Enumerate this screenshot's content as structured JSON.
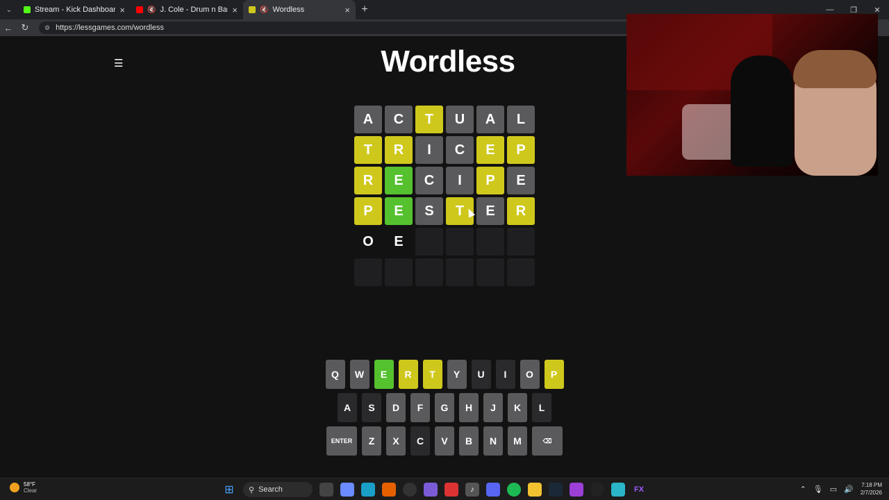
{
  "browser": {
    "tabs": [
      {
        "title": "Stream - Kick Dashboard",
        "color": "#53fc18"
      },
      {
        "title": "J. Cole - Drum n Bass (Official",
        "color": "#ff0000"
      },
      {
        "title": "Wordless",
        "color": "#cfc81c"
      }
    ],
    "url": "https://lessgames.com/wordless"
  },
  "game": {
    "title": "Wordless",
    "rows": [
      [
        {
          "l": "A",
          "s": "g"
        },
        {
          "l": "C",
          "s": "g"
        },
        {
          "l": "T",
          "s": "y"
        },
        {
          "l": "U",
          "s": "g"
        },
        {
          "l": "A",
          "s": "g"
        },
        {
          "l": "L",
          "s": "g"
        }
      ],
      [
        {
          "l": "T",
          "s": "y"
        },
        {
          "l": "R",
          "s": "y"
        },
        {
          "l": "I",
          "s": "g"
        },
        {
          "l": "C",
          "s": "g"
        },
        {
          "l": "E",
          "s": "y"
        },
        {
          "l": "P",
          "s": "y"
        }
      ],
      [
        {
          "l": "R",
          "s": "y"
        },
        {
          "l": "E",
          "s": "gr"
        },
        {
          "l": "C",
          "s": "g"
        },
        {
          "l": "I",
          "s": "g"
        },
        {
          "l": "P",
          "s": "y"
        },
        {
          "l": "E",
          "s": "g"
        }
      ],
      [
        {
          "l": "P",
          "s": "y"
        },
        {
          "l": "E",
          "s": "gr"
        },
        {
          "l": "S",
          "s": "g"
        },
        {
          "l": "T",
          "s": "y"
        },
        {
          "l": "E",
          "s": "g"
        },
        {
          "l": "R",
          "s": "y"
        }
      ],
      [
        {
          "l": "O",
          "s": "b"
        },
        {
          "l": "E",
          "s": "b"
        },
        {
          "l": "",
          "s": "e"
        },
        {
          "l": "",
          "s": "e"
        },
        {
          "l": "",
          "s": "e"
        },
        {
          "l": "",
          "s": "e"
        }
      ],
      [
        {
          "l": "",
          "s": "e"
        },
        {
          "l": "",
          "s": "e"
        },
        {
          "l": "",
          "s": "e"
        },
        {
          "l": "",
          "s": "e"
        },
        {
          "l": "",
          "s": "e"
        },
        {
          "l": "",
          "s": "e"
        }
      ]
    ],
    "keyboard": [
      [
        {
          "k": "Q",
          "s": "g"
        },
        {
          "k": "W",
          "s": "g"
        },
        {
          "k": "E",
          "s": "gr"
        },
        {
          "k": "R",
          "s": "y"
        },
        {
          "k": "T",
          "s": "y"
        },
        {
          "k": "Y",
          "s": "g"
        },
        {
          "k": "U",
          "s": "dark"
        },
        {
          "k": "I",
          "s": "dark"
        },
        {
          "k": "O",
          "s": "g"
        },
        {
          "k": "P",
          "s": "y"
        }
      ],
      [
        {
          "k": "A",
          "s": "dark"
        },
        {
          "k": "S",
          "s": "dark"
        },
        {
          "k": "D",
          "s": "g"
        },
        {
          "k": "F",
          "s": "g"
        },
        {
          "k": "G",
          "s": "g"
        },
        {
          "k": "H",
          "s": "g"
        },
        {
          "k": "J",
          "s": "g"
        },
        {
          "k": "K",
          "s": "g"
        },
        {
          "k": "L",
          "s": "dark"
        }
      ],
      [
        {
          "k": "ENTER",
          "s": "g",
          "wide": true
        },
        {
          "k": "Z",
          "s": "g"
        },
        {
          "k": "X",
          "s": "g"
        },
        {
          "k": "C",
          "s": "dark"
        },
        {
          "k": "V",
          "s": "g"
        },
        {
          "k": "B",
          "s": "g"
        },
        {
          "k": "N",
          "s": "g"
        },
        {
          "k": "M",
          "s": "g"
        },
        {
          "k": "⌫",
          "s": "g",
          "wide": true
        }
      ]
    ]
  },
  "taskbar": {
    "weather_temp": "58°F",
    "weather_desc": "Clear",
    "search_label": "Search",
    "time": "7:18 PM",
    "date": "2/7/2026"
  }
}
